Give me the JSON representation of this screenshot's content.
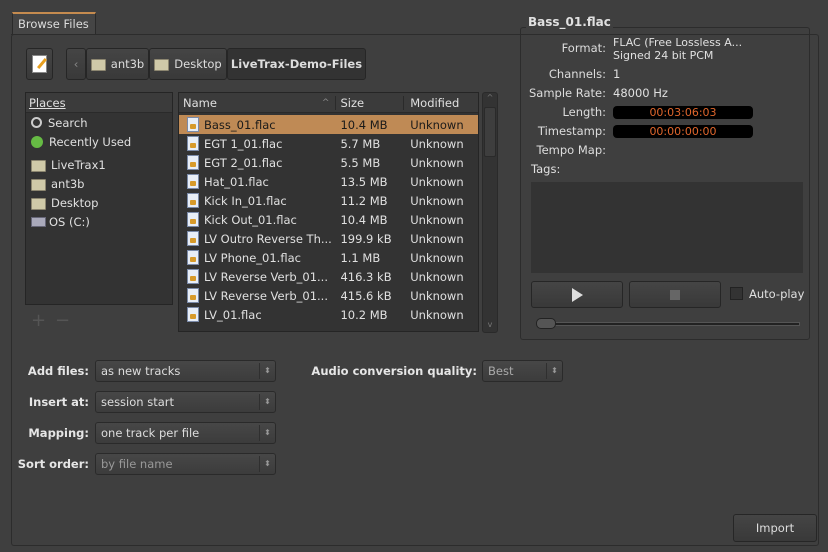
{
  "tab": {
    "label": "Browse Files"
  },
  "breadcrumb": [
    "ant3b",
    "Desktop",
    "LiveTrax-Demo-Files"
  ],
  "places": {
    "header": "Places",
    "items": [
      {
        "label": "Search",
        "icon": "search-icon"
      },
      {
        "label": "Recently Used",
        "icon": "recent-icon"
      },
      {
        "label": "LiveTrax1",
        "icon": "folder-icon"
      },
      {
        "label": "ant3b",
        "icon": "folder-icon"
      },
      {
        "label": "Desktop",
        "icon": "folder-icon"
      },
      {
        "label": "OS (C:)",
        "icon": "drive-icon"
      }
    ],
    "add": "+",
    "remove": "−"
  },
  "files": {
    "columns": [
      "Name",
      "Size",
      "Modified"
    ],
    "rows": [
      {
        "name": "Bass_01.flac",
        "size": "10.4 MB",
        "modified": "Unknown"
      },
      {
        "name": "EGT 1_01.flac",
        "size": "5.7 MB",
        "modified": "Unknown"
      },
      {
        "name": "EGT 2_01.flac",
        "size": "5.5 MB",
        "modified": "Unknown"
      },
      {
        "name": "Hat_01.flac",
        "size": "13.5 MB",
        "modified": "Unknown"
      },
      {
        "name": "Kick In_01.flac",
        "size": "11.2 MB",
        "modified": "Unknown"
      },
      {
        "name": "Kick Out_01.flac",
        "size": "10.4 MB",
        "modified": "Unknown"
      },
      {
        "name": "LV Outro Reverse Th...",
        "size": "199.9 kB",
        "modified": "Unknown"
      },
      {
        "name": "LV Phone_01.flac",
        "size": "1.1 MB",
        "modified": "Unknown"
      },
      {
        "name": "LV Reverse Verb_01...",
        "size": "416.3 kB",
        "modified": "Unknown"
      },
      {
        "name": "LV Reverse Verb_01...",
        "size": "415.6 kB",
        "modified": "Unknown"
      },
      {
        "name": "LV_01.flac",
        "size": "10.2 MB",
        "modified": "Unknown"
      }
    ]
  },
  "info": {
    "title": "Bass_01.flac",
    "format_label": "Format:",
    "format_1": "FLAC (Free Lossless A...",
    "format_2": "Signed 24 bit PCM",
    "channels_label": "Channels:",
    "channels": "1",
    "rate_label": "Sample Rate:",
    "rate": "48000 Hz",
    "length_label": "Length:",
    "length": "00:03:06:03",
    "timestamp_label": "Timestamp:",
    "timestamp": "00:00:00:00",
    "tempo_label": "Tempo Map:",
    "tags_label": "Tags:",
    "autoplay": "Auto-play",
    "seek": 0.0
  },
  "options": {
    "add_files": {
      "label": "Add files:",
      "value": "as new tracks"
    },
    "insert_at": {
      "label": "Insert at:",
      "value": "session start"
    },
    "mapping": {
      "label": "Mapping:",
      "value": "one track per file"
    },
    "sort_order": {
      "label": "Sort order:",
      "value": "by file name"
    },
    "quality": {
      "label": "Audio conversion quality:",
      "value": "Best"
    }
  },
  "import_label": "Import",
  "colors": {
    "selection": "#bf8a55",
    "clock": "#e0662c"
  }
}
